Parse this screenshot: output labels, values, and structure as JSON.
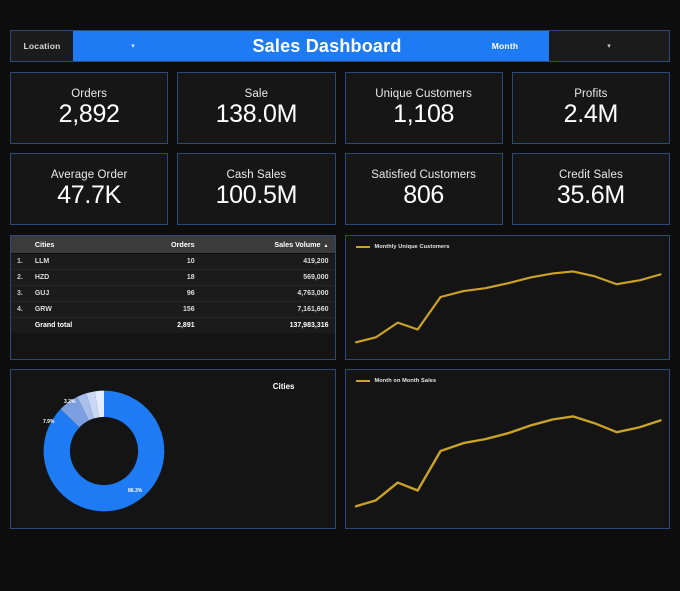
{
  "header": {
    "location_label": "Location",
    "location_value": "",
    "title": "Sales Dashboard",
    "month_label": "Month",
    "month_value": "",
    "caret_icon": "▾",
    "accent_color": "#1f7bf4"
  },
  "kpis": [
    {
      "label": "Orders",
      "value": "2,892"
    },
    {
      "label": "Sale",
      "value": "138.0M"
    },
    {
      "label": "Unique Customers",
      "value": "1,108"
    },
    {
      "label": "Profits",
      "value": "2.4M"
    },
    {
      "label": "Average Order",
      "value": "47.7K"
    },
    {
      "label": "Cash Sales",
      "value": "100.5M"
    },
    {
      "label": "Satisfied Customers",
      "value": "806"
    },
    {
      "label": "Credit Sales",
      "value": "35.6M"
    }
  ],
  "table": {
    "columns": [
      "Cities",
      "Orders",
      "Sales Volume"
    ],
    "sort_caret": "▲",
    "rows": [
      {
        "index": "1.",
        "city": "LLM",
        "orders": "10",
        "volume": "419,200"
      },
      {
        "index": "2.",
        "city": "HZD",
        "orders": "18",
        "volume": "569,000"
      },
      {
        "index": "3.",
        "city": "GUJ",
        "orders": "96",
        "volume": "4,763,000"
      },
      {
        "index": "4.",
        "city": "GRW",
        "orders": "156",
        "volume": "7,161,660"
      }
    ],
    "total": {
      "label": "Grand total",
      "orders": "2,891",
      "volume": "137,983,316"
    }
  },
  "donut": {
    "title": "Cities",
    "slices": [
      {
        "label": "86.3%",
        "value": 86.3,
        "color": "#1f7bf4"
      },
      {
        "label": "7.9%",
        "value": 7.9,
        "color": "#7c9fe0"
      },
      {
        "label": "3.2%",
        "value": 3.2,
        "color": "#a8bfeb"
      },
      {
        "label": "",
        "value": 1.6,
        "color": "#c9d8f5"
      },
      {
        "label": "",
        "value": 1.0,
        "color": "#e4ecfb"
      }
    ]
  },
  "chart_data": [
    {
      "type": "line",
      "title": "Monthly Unique Customers",
      "legend": "Monthly Unique Customers",
      "legend_position": "top-left",
      "xlabel": "",
      "ylabel": "",
      "grid": false,
      "color": "#c9a227",
      "x": [
        1,
        2,
        3,
        4,
        5,
        6,
        7,
        8,
        9,
        10,
        11,
        12,
        13,
        14,
        15
      ],
      "values": [
        8,
        12,
        24,
        17,
        54,
        62,
        66,
        72,
        80,
        86,
        88,
        82,
        72,
        78,
        86
      ],
      "ylim": [
        0,
        100
      ]
    },
    {
      "type": "line",
      "title": "Month on Month Sales",
      "legend": "Month on Month Sales",
      "legend_position": "top-left",
      "xlabel": "",
      "ylabel": "",
      "grid": false,
      "color": "#c9a227",
      "x": [
        1,
        2,
        3,
        4,
        5,
        6,
        7,
        8,
        9,
        10,
        11,
        12,
        13,
        14,
        15
      ],
      "values": [
        8,
        12,
        24,
        17,
        54,
        62,
        66,
        72,
        80,
        86,
        88,
        82,
        72,
        78,
        86
      ],
      "ylim": [
        0,
        100
      ]
    },
    {
      "type": "pie",
      "title": "Cities",
      "labels": [
        "86.3%",
        "7.9%",
        "3.2%",
        "",
        ""
      ],
      "values": [
        86.3,
        7.9,
        3.2,
        1.6,
        1.0
      ],
      "colors": [
        "#1f7bf4",
        "#7c9fe0",
        "#a8bfeb",
        "#c9d8f5",
        "#e4ecfb"
      ],
      "donut": true
    },
    {
      "type": "table",
      "title": "Cities / Orders / Sales Volume",
      "columns": [
        "Cities",
        "Orders",
        "Sales Volume"
      ],
      "rows": [
        [
          "LLM",
          10,
          419200
        ],
        [
          "HZD",
          18,
          569000
        ],
        [
          "GUJ",
          96,
          4763000
        ],
        [
          "GRW",
          156,
          7161660
        ]
      ],
      "total": [
        "Grand total",
        2891,
        137983316
      ]
    }
  ]
}
